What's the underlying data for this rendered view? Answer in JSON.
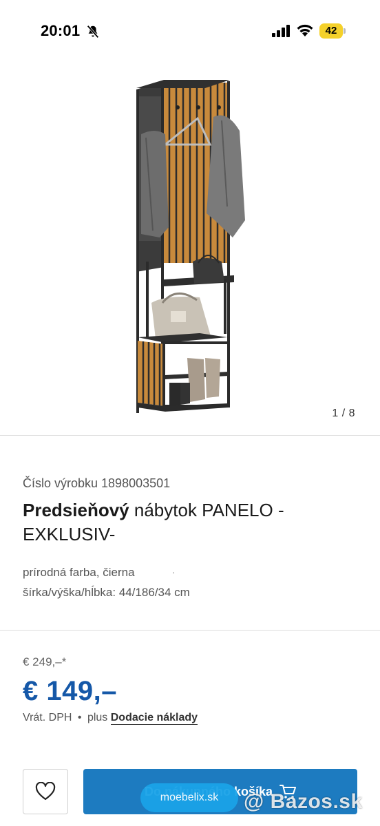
{
  "status_bar": {
    "time": "20:01",
    "battery_level": "42",
    "battery_color": "#f5d12a"
  },
  "gallery": {
    "counter": "1 / 8"
  },
  "product": {
    "number_label": "Číslo výrobku 1898003501",
    "title_bold": "Predsieňový",
    "title_rest": "nábytok PANELO - EXKLUSIV-",
    "attr_color": "prírodná farba, čierna",
    "attr_separator": "·",
    "attr_dimensions": "šírka/výška/hĺbka: 44/186/34 cm"
  },
  "pricing": {
    "old_price": "€ 249,–*",
    "new_price": "€ 149,–",
    "vat_text": "Vrát. DPH",
    "bullet": "•",
    "plus_text": "plus",
    "shipping_link": "Dodacie náklady",
    "price_color": "#1558a8"
  },
  "actions": {
    "cart_button_label": "Do nákupného košíka",
    "cart_button_color": "#1d7bc0",
    "url_pill": "moebelix.sk",
    "watermark": "@ Bazos.sk"
  },
  "icons": {
    "bell": "bell-off-icon",
    "signal": "signal-icon",
    "wifi": "wifi-icon",
    "favorite": "heart-icon",
    "cart": "cart-icon"
  }
}
